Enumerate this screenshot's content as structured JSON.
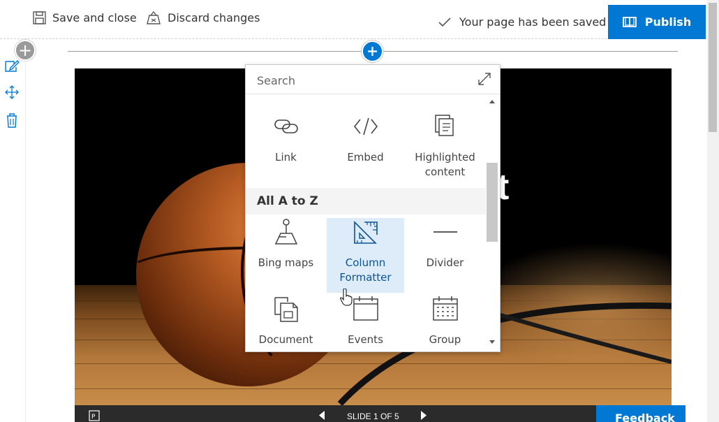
{
  "commandbar": {
    "save_close": "Save and close",
    "discard": "Discard changes",
    "status": "Your page has been saved",
    "publish": "Publish"
  },
  "hero": {
    "title_fragment": "t"
  },
  "picker": {
    "search_placeholder": "Search",
    "row1": [
      {
        "icon": "link-icon",
        "label": "Link"
      },
      {
        "icon": "embed-icon",
        "label": "Embed"
      },
      {
        "icon": "highlighted-content-icon",
        "label_line1": "Highlighted",
        "label_line2": "content"
      }
    ],
    "group_header": "All A to Z",
    "row2": [
      {
        "icon": "bing-maps-icon",
        "label": "Bing maps"
      },
      {
        "icon": "column-formatter-icon",
        "label_line1": "Column",
        "label_line2": "Formatter",
        "selected": true
      },
      {
        "icon": "divider-icon",
        "label": "Divider"
      }
    ],
    "row3": [
      {
        "icon": "document-icon",
        "label": "Document"
      },
      {
        "icon": "events-icon",
        "label": "Events"
      },
      {
        "icon": "group-icon",
        "label": "Group"
      }
    ]
  },
  "slideshow": {
    "counter": "SLIDE 1 OF 5"
  },
  "feedback": "Feedback",
  "colors": {
    "accent": "#0078d4",
    "selected_tile": "#deecf9"
  }
}
